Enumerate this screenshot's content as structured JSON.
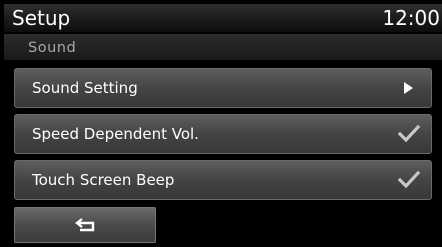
{
  "header": {
    "title": "Setup",
    "clock": "12:00"
  },
  "breadcrumb": {
    "label": "Sound"
  },
  "menu": {
    "items": [
      {
        "label": "Sound Setting",
        "control": "arrow-right-icon"
      },
      {
        "label": "Speed Dependent Vol.",
        "control": "checkbox",
        "checked": true
      },
      {
        "label": "Touch Screen Beep",
        "control": "checkbox",
        "checked": true
      }
    ]
  },
  "footer": {
    "back_icon": "back-return-icon"
  },
  "colors": {
    "background": "#000000",
    "button_face": "#4a4a4a",
    "text": "#ffffff",
    "breadcrumb_text": "#a8a8a8",
    "check_mark": "#c8c8c8"
  }
}
